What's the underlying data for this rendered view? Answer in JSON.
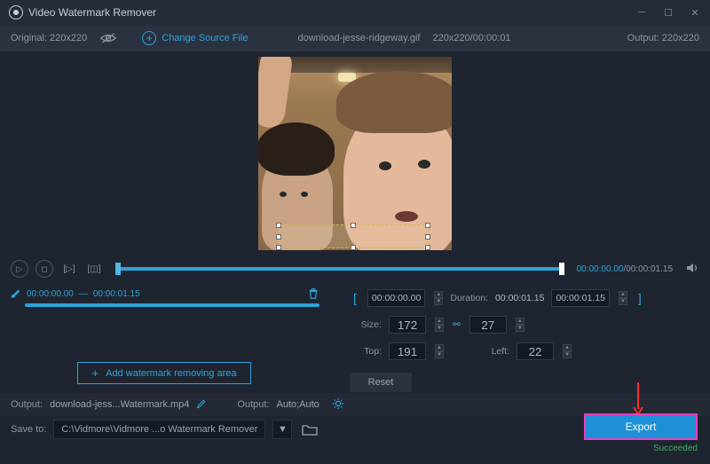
{
  "titlebar": {
    "title": "Video Watermark Remover"
  },
  "topbar": {
    "original_label": "Original:",
    "original_dims": "220x220",
    "change_source": "Change Source File",
    "source_file": "download-jesse-ridgeway.gif",
    "source_info": "220x220/00:00:01",
    "output_label": "Output:",
    "output_dims": "220x220"
  },
  "playback": {
    "current_time": "00:00:00.00",
    "total_time": "00:00:01.15"
  },
  "clip": {
    "start": "00:00:00.00",
    "end": "00:00:01.15",
    "add_area_label": "Add watermark removing area"
  },
  "region": {
    "trim_start": "00:00:00.00",
    "duration_label": "Duration:",
    "duration_value": "00:00:01.15",
    "trim_end": "00:00:01.15",
    "size_label": "Size:",
    "size_w": "172",
    "size_h": "27",
    "top_label": "Top:",
    "top_val": "191",
    "left_label": "Left:",
    "left_val": "22",
    "reset_label": "Reset"
  },
  "output": {
    "output_label": "Output:",
    "output_file": "download-jess...Watermark.mp4",
    "format_label": "Output:",
    "format_value": "Auto;Auto",
    "save_to_label": "Save to:",
    "save_to_path": "C:\\Vidmore\\Vidmore ...o Watermark Remover"
  },
  "export": {
    "button_label": "Export",
    "status": "Succeeded"
  }
}
